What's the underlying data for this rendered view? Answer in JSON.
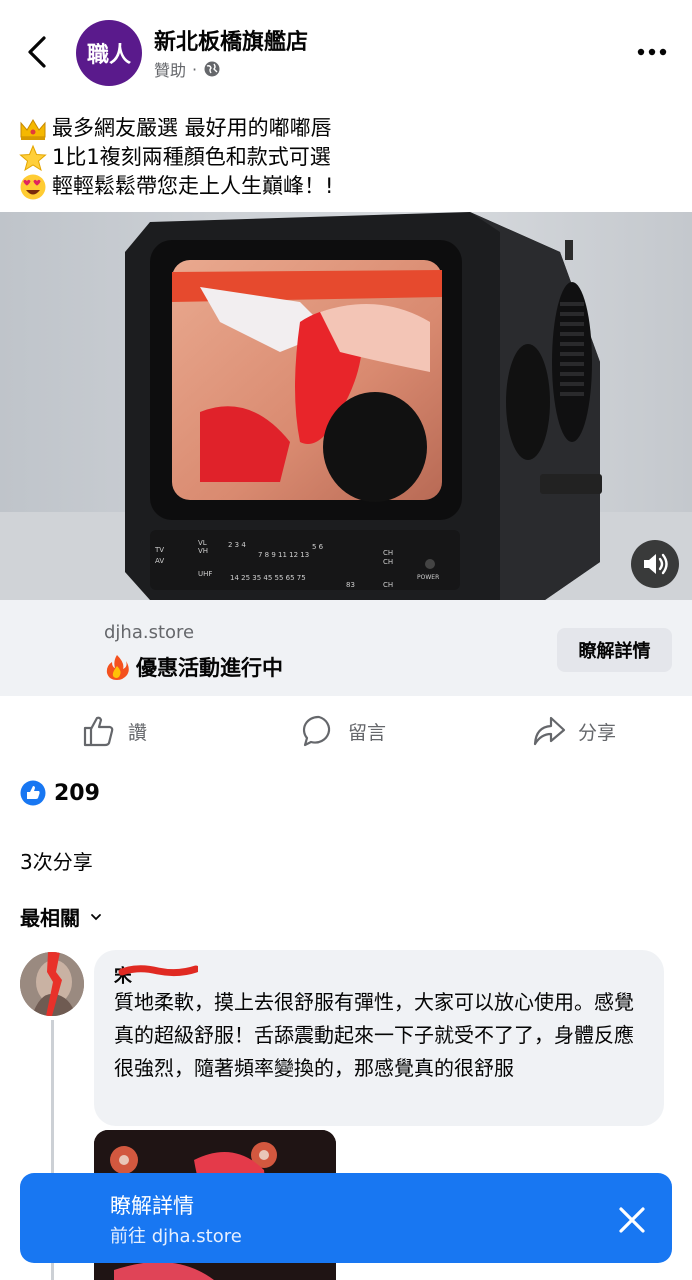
{
  "header": {
    "page_name": "新北板橋旗艦店",
    "sponsored": "贊助",
    "dot": "·",
    "avatar_text": "職人"
  },
  "caption": {
    "lines": [
      {
        "icon": "crown-emoji",
        "text": "最多網友嚴選 最好用的嘟嘟唇"
      },
      {
        "icon": "star-emoji",
        "text": "1比1複刻兩種顏色和款式可選"
      },
      {
        "icon": "heart-eyes-emoji",
        "text": "輕輕鬆鬆帶您走上人生巔峰！!"
      }
    ]
  },
  "media": {
    "tv_labels": {
      "vl": "VL",
      "vh": "VH",
      "uhf": "UHF",
      "tv": "TV",
      "av": "AV",
      "ch1": "CH",
      "ch2": "CH",
      "ch3": "CH",
      "power": "POWER",
      "vl_nums": "2 3 4",
      "vh_nums": "7 8 9 11 12 13",
      "vh_top": "5 6",
      "uhf_nums": "14 25 35 45 55 65 75",
      "uhf_end": "83"
    },
    "sound_icon": "speaker-icon"
  },
  "link_card": {
    "domain": "djha.store",
    "title": "優惠活動進行中",
    "title_icon": "fire-emoji",
    "button": "瞭解詳情"
  },
  "actions": {
    "like": "讚",
    "comment": "留言",
    "share": "分享"
  },
  "stats": {
    "likes": "209",
    "shares": "3次分享"
  },
  "sort": {
    "label": "最相關"
  },
  "comment": {
    "author": "宋",
    "text": "質地柔軟，摸上去很舒服有彈性，大家可以放心使用。感覺真的超級舒服！舌舔震動起來一下子就受不了了，身體反應很強烈，隨著頻率變換的，那感覺真的很舒服"
  },
  "cta": {
    "title": "瞭解詳情",
    "subtitle": "前往 djha.store"
  },
  "colors": {
    "facebook_blue": "#1877f2",
    "secondary_text": "#65676b",
    "card_bg": "#f0f2f5"
  }
}
